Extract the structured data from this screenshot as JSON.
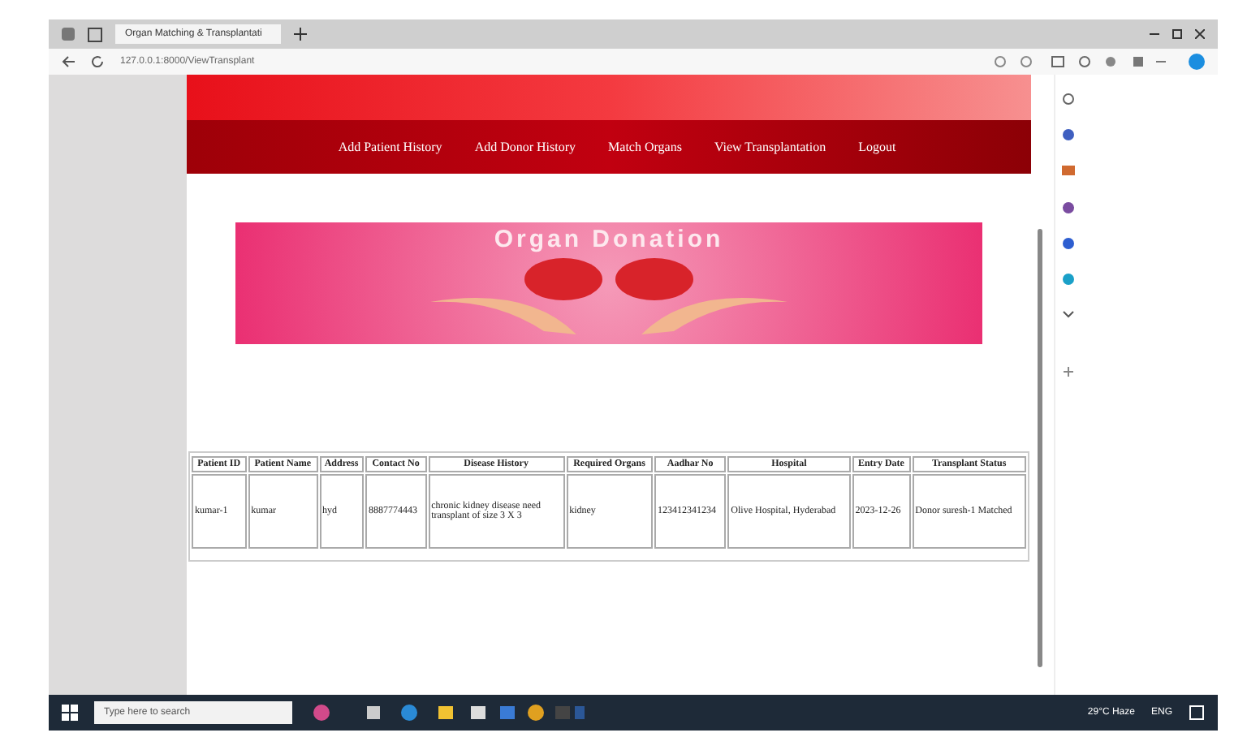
{
  "browser": {
    "tab_title": "Organ Matching & Transplantati",
    "url": "127.0.0.1:8000/ViewTransplant"
  },
  "nav": [
    "Add Patient History",
    "Add Donor History",
    "Match Organs",
    "View Transplantation",
    "Logout"
  ],
  "banner": {
    "title": "Organ Donation"
  },
  "table": {
    "columns": [
      "Patient ID",
      "Patient Name",
      "Address",
      "Contact No",
      "Disease History",
      "Required Organs",
      "Aadhar No",
      "Hospital",
      "Entry Date",
      "Transplant Status"
    ],
    "rows": [
      [
        "kumar-1",
        "kumar",
        "hyd",
        "8887774443",
        "chronic kidney disease need transplant of size 3 X 3",
        "kidney",
        "123412341234",
        "Olive Hospital, Hyderabad",
        "2023-12-26",
        "Donor suresh-1 Matched"
      ]
    ]
  },
  "taskbar": {
    "search_placeholder": "Type here to search",
    "weather": "29°C Haze",
    "language": "ENG"
  }
}
